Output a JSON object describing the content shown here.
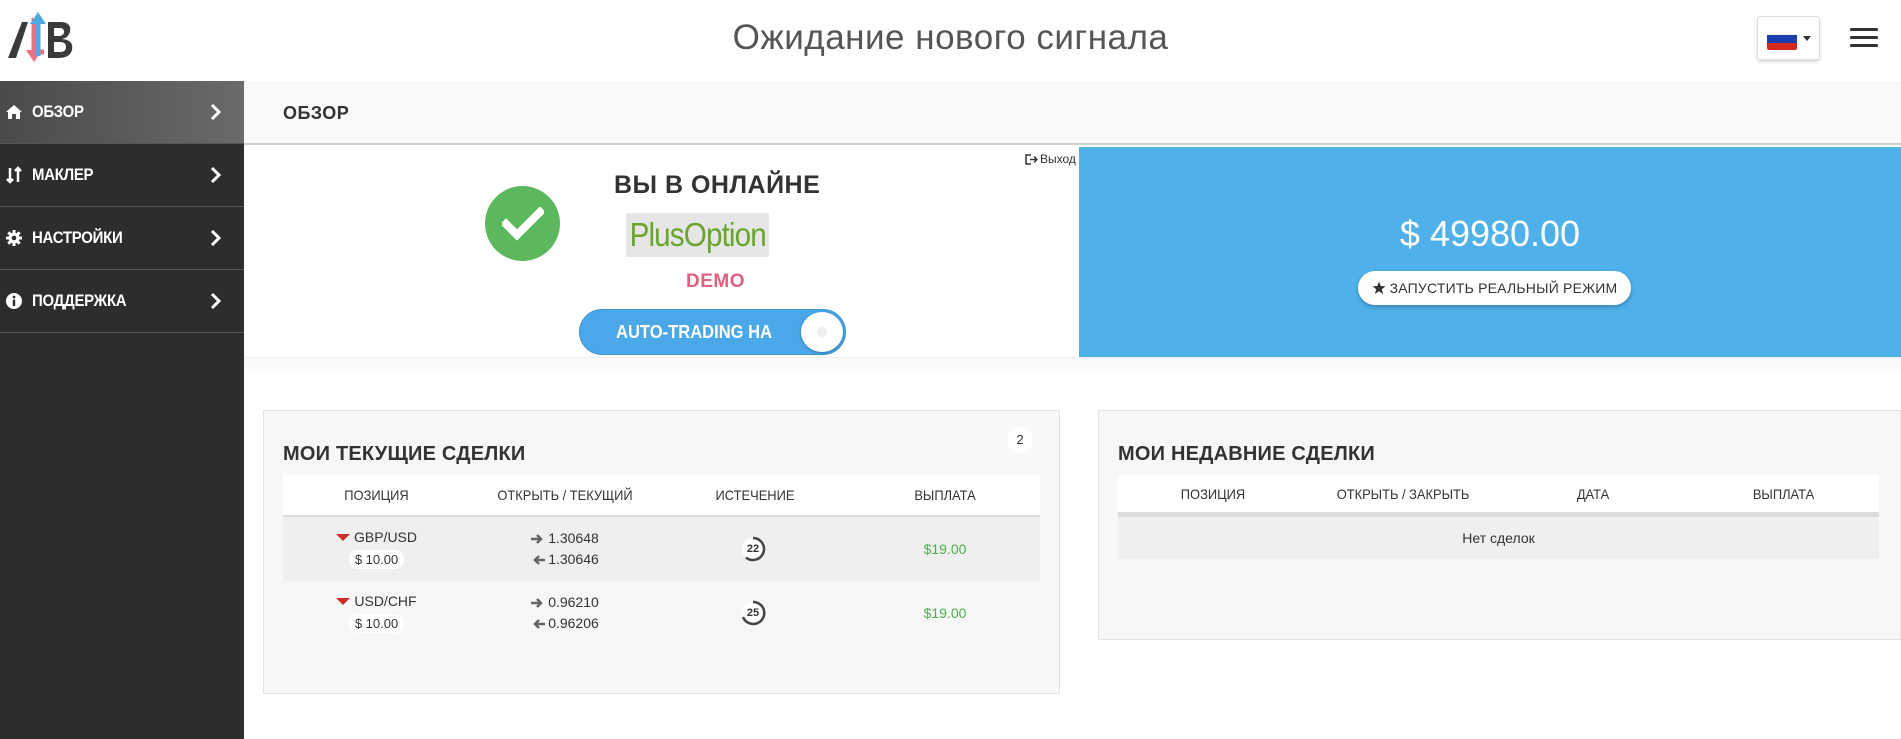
{
  "header": {
    "title": "Ожидание нового сигнала",
    "logo_icon": "lb-logo-icon",
    "flag_icon": "russia-flag-icon",
    "menu_icon": "hamburger-icon"
  },
  "sidebar": {
    "items": [
      {
        "label": "ОБЗОР",
        "icon": "home-icon",
        "active": true
      },
      {
        "label": "МАКЛЕР",
        "icon": "sort-arrows-icon",
        "active": false
      },
      {
        "label": "НАСТРОЙКИ",
        "icon": "gear-icon",
        "active": false
      },
      {
        "label": "ПОДДЕРЖКА",
        "icon": "info-icon",
        "active": false
      }
    ]
  },
  "breadcrumb": {
    "title": "ОБЗОР"
  },
  "status": {
    "online_title": "ВЫ В ОНЛАЙНЕ",
    "broker_logo_text": "PlusOption",
    "account_type": "DEMO",
    "autotrading_label": "AUTO-TRADING НА",
    "logout_label": "Выход"
  },
  "balance": {
    "amount": "$ 49980.00",
    "real_mode_button": "ЗАПУСТИТЬ РЕАЛЬНЫЙ РЕЖИМ"
  },
  "current_trades": {
    "title": "МОИ ТЕКУЩИЕ СДЕЛКИ",
    "count": "2",
    "columns": [
      "ПОЗИЦИЯ",
      "ОТКРЫТЬ / ТЕКУЩИЙ",
      "ИСТЕЧЕНИЕ",
      "ВЫПЛАТА"
    ],
    "rows": [
      {
        "pair": "GBP/USD",
        "amount": "$ 10.00",
        "open": "1.30648",
        "current": "1.30646",
        "expiry": "22",
        "payout": "$19.00"
      },
      {
        "pair": "USD/CHF",
        "amount": "$ 10.00",
        "open": "0.96210",
        "current": "0.96206",
        "expiry": "25",
        "payout": "$19.00"
      }
    ]
  },
  "recent_trades": {
    "title": "МОИ НЕДАВНИЕ СДЕЛКИ",
    "columns": [
      "ПОЗИЦИЯ",
      "ОТКРЫТЬ / ЗАКРЫТЬ",
      "ДАТА",
      "ВЫПЛАТА"
    ],
    "empty_text": "Нет сделок"
  },
  "colors": {
    "sidebar_bg": "#2d2d2d",
    "balance_bg": "#4fb0ea",
    "online_check": "#5cb85c",
    "demo": "#e0607e",
    "payout": "#4cae4c",
    "direction_down": "#c9302c"
  }
}
